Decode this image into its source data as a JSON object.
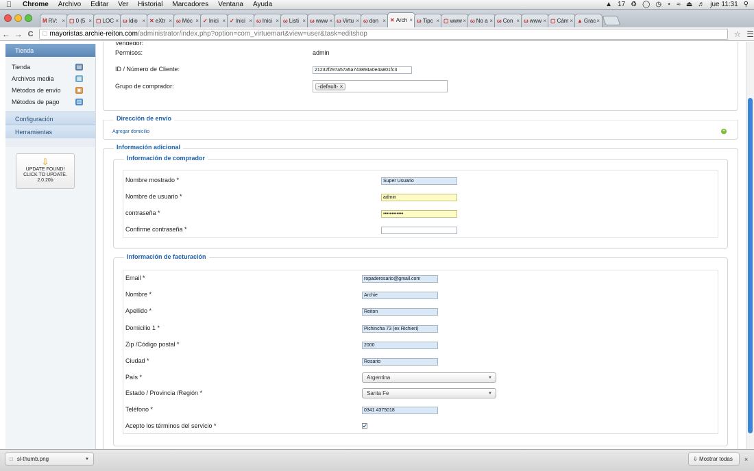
{
  "menubar": {
    "apple": "",
    "app": "Chrome",
    "menus": [
      "Archivo",
      "Editar",
      "Ver",
      "Historial",
      "Marcadores",
      "Ventana",
      "Ayuda"
    ],
    "status_count": "17",
    "clock": "jue 11:31"
  },
  "tabs": [
    {
      "icon": "M",
      "title": "RV:"
    },
    {
      "icon": "▢",
      "title": "0 (5"
    },
    {
      "icon": "▢",
      "title": "LOC"
    },
    {
      "icon": "ω",
      "title": "Idio"
    },
    {
      "icon": "✕",
      "title": "eXtr"
    },
    {
      "icon": "ω",
      "title": "Móc"
    },
    {
      "icon": "✓",
      "title": "Inici"
    },
    {
      "icon": "✓",
      "title": "Inici"
    },
    {
      "icon": "ω",
      "title": "Inici"
    },
    {
      "icon": "ω",
      "title": "Listi"
    },
    {
      "icon": "ω",
      "title": "www"
    },
    {
      "icon": "ω",
      "title": "Virtu"
    },
    {
      "icon": "ω",
      "title": "don"
    },
    {
      "icon": "✕",
      "title": "Arch"
    },
    {
      "icon": "ω",
      "title": "Tipc"
    },
    {
      "icon": "▢",
      "title": "www"
    },
    {
      "icon": "ω",
      "title": "No a"
    },
    {
      "icon": "ω",
      "title": "Con"
    },
    {
      "icon": "ω",
      "title": "www"
    },
    {
      "icon": "▢",
      "title": "Cám"
    },
    {
      "icon": "▲",
      "title": "Grac"
    }
  ],
  "toolbar": {
    "back": "←",
    "forward": "→",
    "reload": "C",
    "url_host": "mayoristas.archie-reiton.com",
    "url_path": "/administrator/index.php?option=com_virtuemart&view=user&task=editshop"
  },
  "sidebar": {
    "header": "Tienda",
    "items": [
      {
        "label": "Tienda",
        "icon": "▤"
      },
      {
        "label": "Archivos media",
        "icon": "▦"
      },
      {
        "label": "Métodos de envío",
        "icon": "▣"
      },
      {
        "label": "Métodos de pago",
        "icon": "▥"
      }
    ],
    "sections": [
      "Configuración",
      "Herramientas"
    ],
    "update": {
      "icon": "⇩",
      "line1": "UPDATE FOUND!",
      "line2": "CLICK TO UPDATE.",
      "version": "2.0.20b"
    }
  },
  "top_panel": {
    "cut_label": "Vendedor:",
    "permisos_label": "Permisos:",
    "permisos_value": "admin",
    "id_label": "ID / Número de Cliente:",
    "id_value": "21232f297a57a5a743894a0e4a801fc3",
    "grupo_label": "Grupo de comprador:",
    "grupo_chip": "-default-",
    "grupo_chip_close": "×"
  },
  "envio": {
    "legend": "Dirección de envío",
    "link": "Agregar domicilio",
    "add_icon": "+"
  },
  "adicional": {
    "legend": "Información adicional",
    "comprador": {
      "legend": "Información de comprador",
      "fields": [
        {
          "label": "Nombre mostrado *",
          "value": "Super Usuario"
        },
        {
          "label": "Nombre de usuario *",
          "value": "admin"
        },
        {
          "label": "contraseña *",
          "value": "••••••••••••"
        },
        {
          "label": "Confirme contraseña *",
          "value": ""
        }
      ]
    },
    "facturacion": {
      "legend": "Información de facturación",
      "fields": [
        {
          "label": "Email *",
          "value": "ropaderosario@gmail.com"
        },
        {
          "label": "Nombre *",
          "value": "Archie"
        },
        {
          "label": "Apellido *",
          "value": "Reiton"
        },
        {
          "label": "Domicilio 1 *",
          "value": "Pichincha 73 (ex Richieri)"
        },
        {
          "label": "Zip /Código postal *",
          "value": "2000"
        },
        {
          "label": "Ciudad *",
          "value": "Rosario"
        },
        {
          "label": "País *",
          "value": "Argentina"
        },
        {
          "label": "Estado / Provincia /Región *",
          "value": "Santa Fe"
        },
        {
          "label": "Teléfono *",
          "value": "0341 4375018"
        },
        {
          "label": "Acepto los términos del servicio *",
          "value": "✔"
        }
      ]
    }
  },
  "downloads": {
    "file": "sl-thumb.png",
    "show_all": "Mostrar todas",
    "close": "×"
  },
  "colors": {
    "accent": "#1a5ea8",
    "sidebar_header": "#5b86b6",
    "field_blue": "#d9e9f8",
    "field_yellow": "#fdfbc6"
  }
}
